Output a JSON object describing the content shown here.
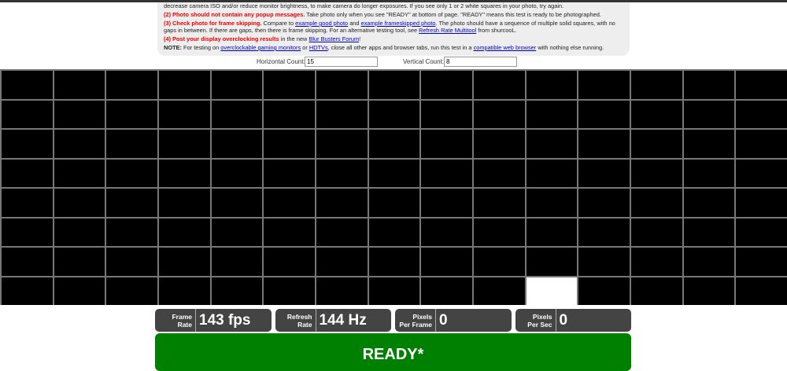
{
  "instructions": {
    "line1": "decrease camera ISO and/or reduce monitor brightness, to make camera do longer exposures. If you see only 1 or 2 white squares in your photo, try again.",
    "step2_bold": "(2) Photo should not contain any popup messages.",
    "step2_text": " Take photo only when you see \"READY\" at bottom of page. \"READY\" means this test is ready to be photographed.",
    "step3_bold": "(3) Check photo for frame skipping.",
    "step3_a": " Compare to ",
    "link_good": "example good photo",
    "step3_b": " and ",
    "link_skipped": "example frameskipped photo",
    "step3_c": ". The photo should have a sequence of multiple solid squares, with no gaps in between. If there are gaps, then there is frame skipping. For an alternative testing tool, see ",
    "link_multitool": "Refresh Rate Multitool",
    "step3_d": " from shurcooL.",
    "step4_bold": "(4) Post your display overclocking results",
    "step4_a": " in the new ",
    "link_forum": "Blur Busters Forum",
    "step4_b": "!",
    "note_bold": "NOTE:",
    "note_a": " For testing on ",
    "link_monitors": "overclockable gaming monitors",
    "note_b": " or ",
    "link_hdtvs": "HDTVs",
    "note_c": ", close all other apps and browser tabs, run this test in a ",
    "link_browser": "compatible web browser",
    "note_d": " with nothing else running."
  },
  "counts": {
    "h_label": "Horizontal Count:",
    "h_value": "15",
    "v_label": "Vertical Count:",
    "v_value": "8"
  },
  "grid": {
    "cols": 15,
    "rows": 8,
    "lit_cell": {
      "row": 7,
      "col": 10
    }
  },
  "stats": [
    {
      "label": "Frame\nRate",
      "value": "143 fps"
    },
    {
      "label": "Refresh\nRate",
      "value": "144 Hz"
    },
    {
      "label": "Pixels\nPer Frame",
      "value": "0"
    },
    {
      "label": "Pixels\nPer Sec",
      "value": "0"
    }
  ],
  "status": "READY*"
}
